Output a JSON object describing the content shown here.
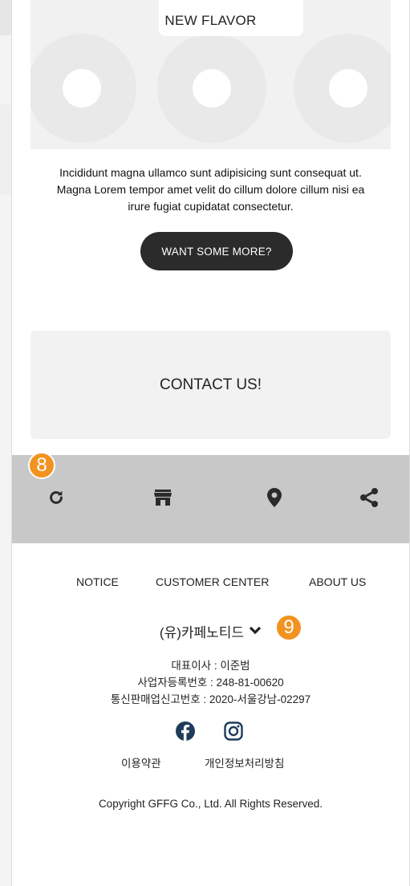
{
  "banner": {
    "title": "NEW FLAVOR"
  },
  "description": {
    "line1": "Incididunt magna ullamco sunt adipisicing sunt consequat ut.",
    "line2": "Magna Lorem tempor amet velit do cillum dolore cillum nisi ea",
    "line3": "irure fugiat cupidatat consectetur."
  },
  "more_button": {
    "label": "WANT SOME MORE?"
  },
  "contact": {
    "label": "CONTACT US!"
  },
  "tabbar": {
    "badge": "8",
    "icons": [
      "refresh-icon",
      "store-icon",
      "location-pin-icon",
      "share-icon"
    ]
  },
  "footer": {
    "nav": [
      "NOTICE",
      "CUSTOMER CENTER",
      "ABOUT US"
    ],
    "company_name": "(유)카페노티드",
    "company_badge": "9",
    "ceo": "대표이사 : 이준범",
    "business_reg": "사업자등록번호 : 248-81-00620",
    "mail_order_reg": "통신판매업신고번호 : 2020-서울강남-02297",
    "social": [
      "facebook-icon",
      "instagram-icon"
    ],
    "terms": "이용약관",
    "privacy": "개인정보처리방침",
    "copyright": "Copyright GFFG Co., Ltd. All Rights Reserved."
  },
  "colors": {
    "badge": "#f29321",
    "tabbar": "#c8c8c8",
    "button": "#2b2b2b",
    "icon_dark": "#2b2b2b",
    "social_blue": "#1f3b5a"
  }
}
